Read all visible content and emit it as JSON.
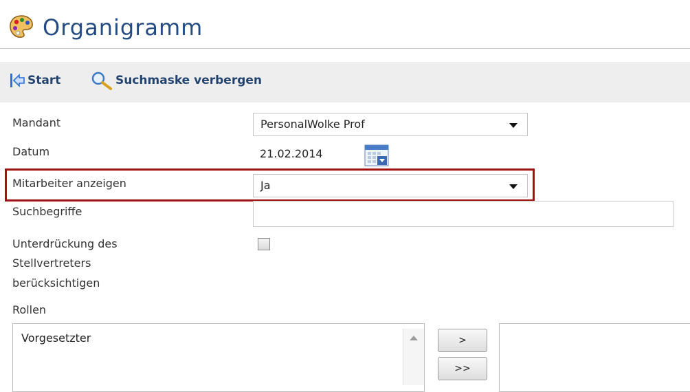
{
  "header": {
    "title": "Organigramm",
    "icon": "palette-icon"
  },
  "toolbar": {
    "start_label": "Start",
    "search_toggle_label": "Suchmaske verbergen"
  },
  "form": {
    "mandant": {
      "label": "Mandant",
      "value": "PersonalWolke Prof"
    },
    "datum": {
      "label": "Datum",
      "value": "21.02.2014"
    },
    "mitarbeiter": {
      "label": "Mitarbeiter anzeigen",
      "value": "Ja"
    },
    "suchbegriffe": {
      "label": "Suchbegriffe",
      "value": ""
    },
    "unterdrueckung": {
      "label_line1": "Unterdrückung des",
      "label_line2": "Stellvertreters",
      "label_line3": "berücksichtigen",
      "checked": false
    },
    "rollen": {
      "label": "Rollen",
      "available": [
        "Vorgesetzter"
      ],
      "selected": []
    }
  },
  "buttons": {
    "add_one": ">",
    "add_all": ">>"
  },
  "colors": {
    "title": "#244b82",
    "highlight": "#a01010",
    "toolbar_bg": "#eeeeee"
  }
}
